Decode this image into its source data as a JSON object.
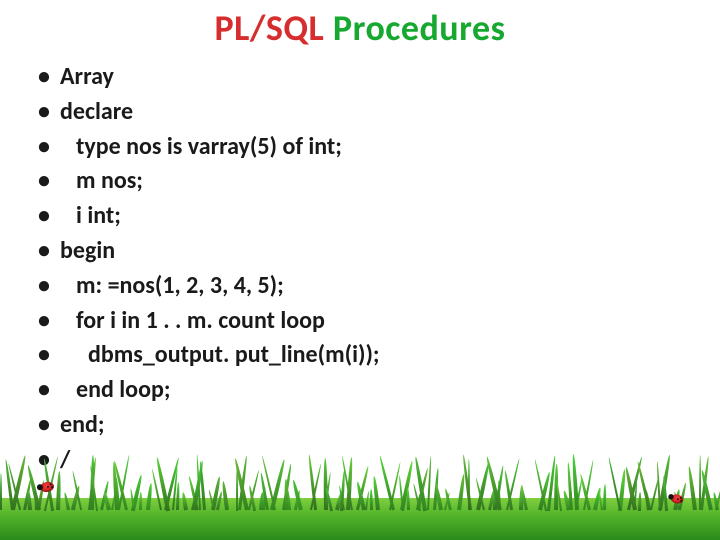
{
  "title": {
    "w1": "PL/SQL",
    "w2": "Procedures"
  },
  "bullets": [
    {
      "text": "Array",
      "indent": 0
    },
    {
      "text": "declare",
      "indent": 0
    },
    {
      "text": "type nos is varray(5) of int;",
      "indent": 1
    },
    {
      "text": "m nos;",
      "indent": 1
    },
    {
      "text": "i int;",
      "indent": 1
    },
    {
      "text": "begin",
      "indent": 0
    },
    {
      "text": "m: =nos(1, 2, 3, 4, 5);",
      "indent": 1
    },
    {
      "text": "for i in 1 . . m. count loop",
      "indent": 1
    },
    {
      "text": "dbms_output. put_line(m(i));",
      "indent": 2
    },
    {
      "text": "end loop;",
      "indent": 1
    },
    {
      "text": "end;",
      "indent": 0
    },
    {
      "text": "/",
      "indent": 0
    }
  ]
}
